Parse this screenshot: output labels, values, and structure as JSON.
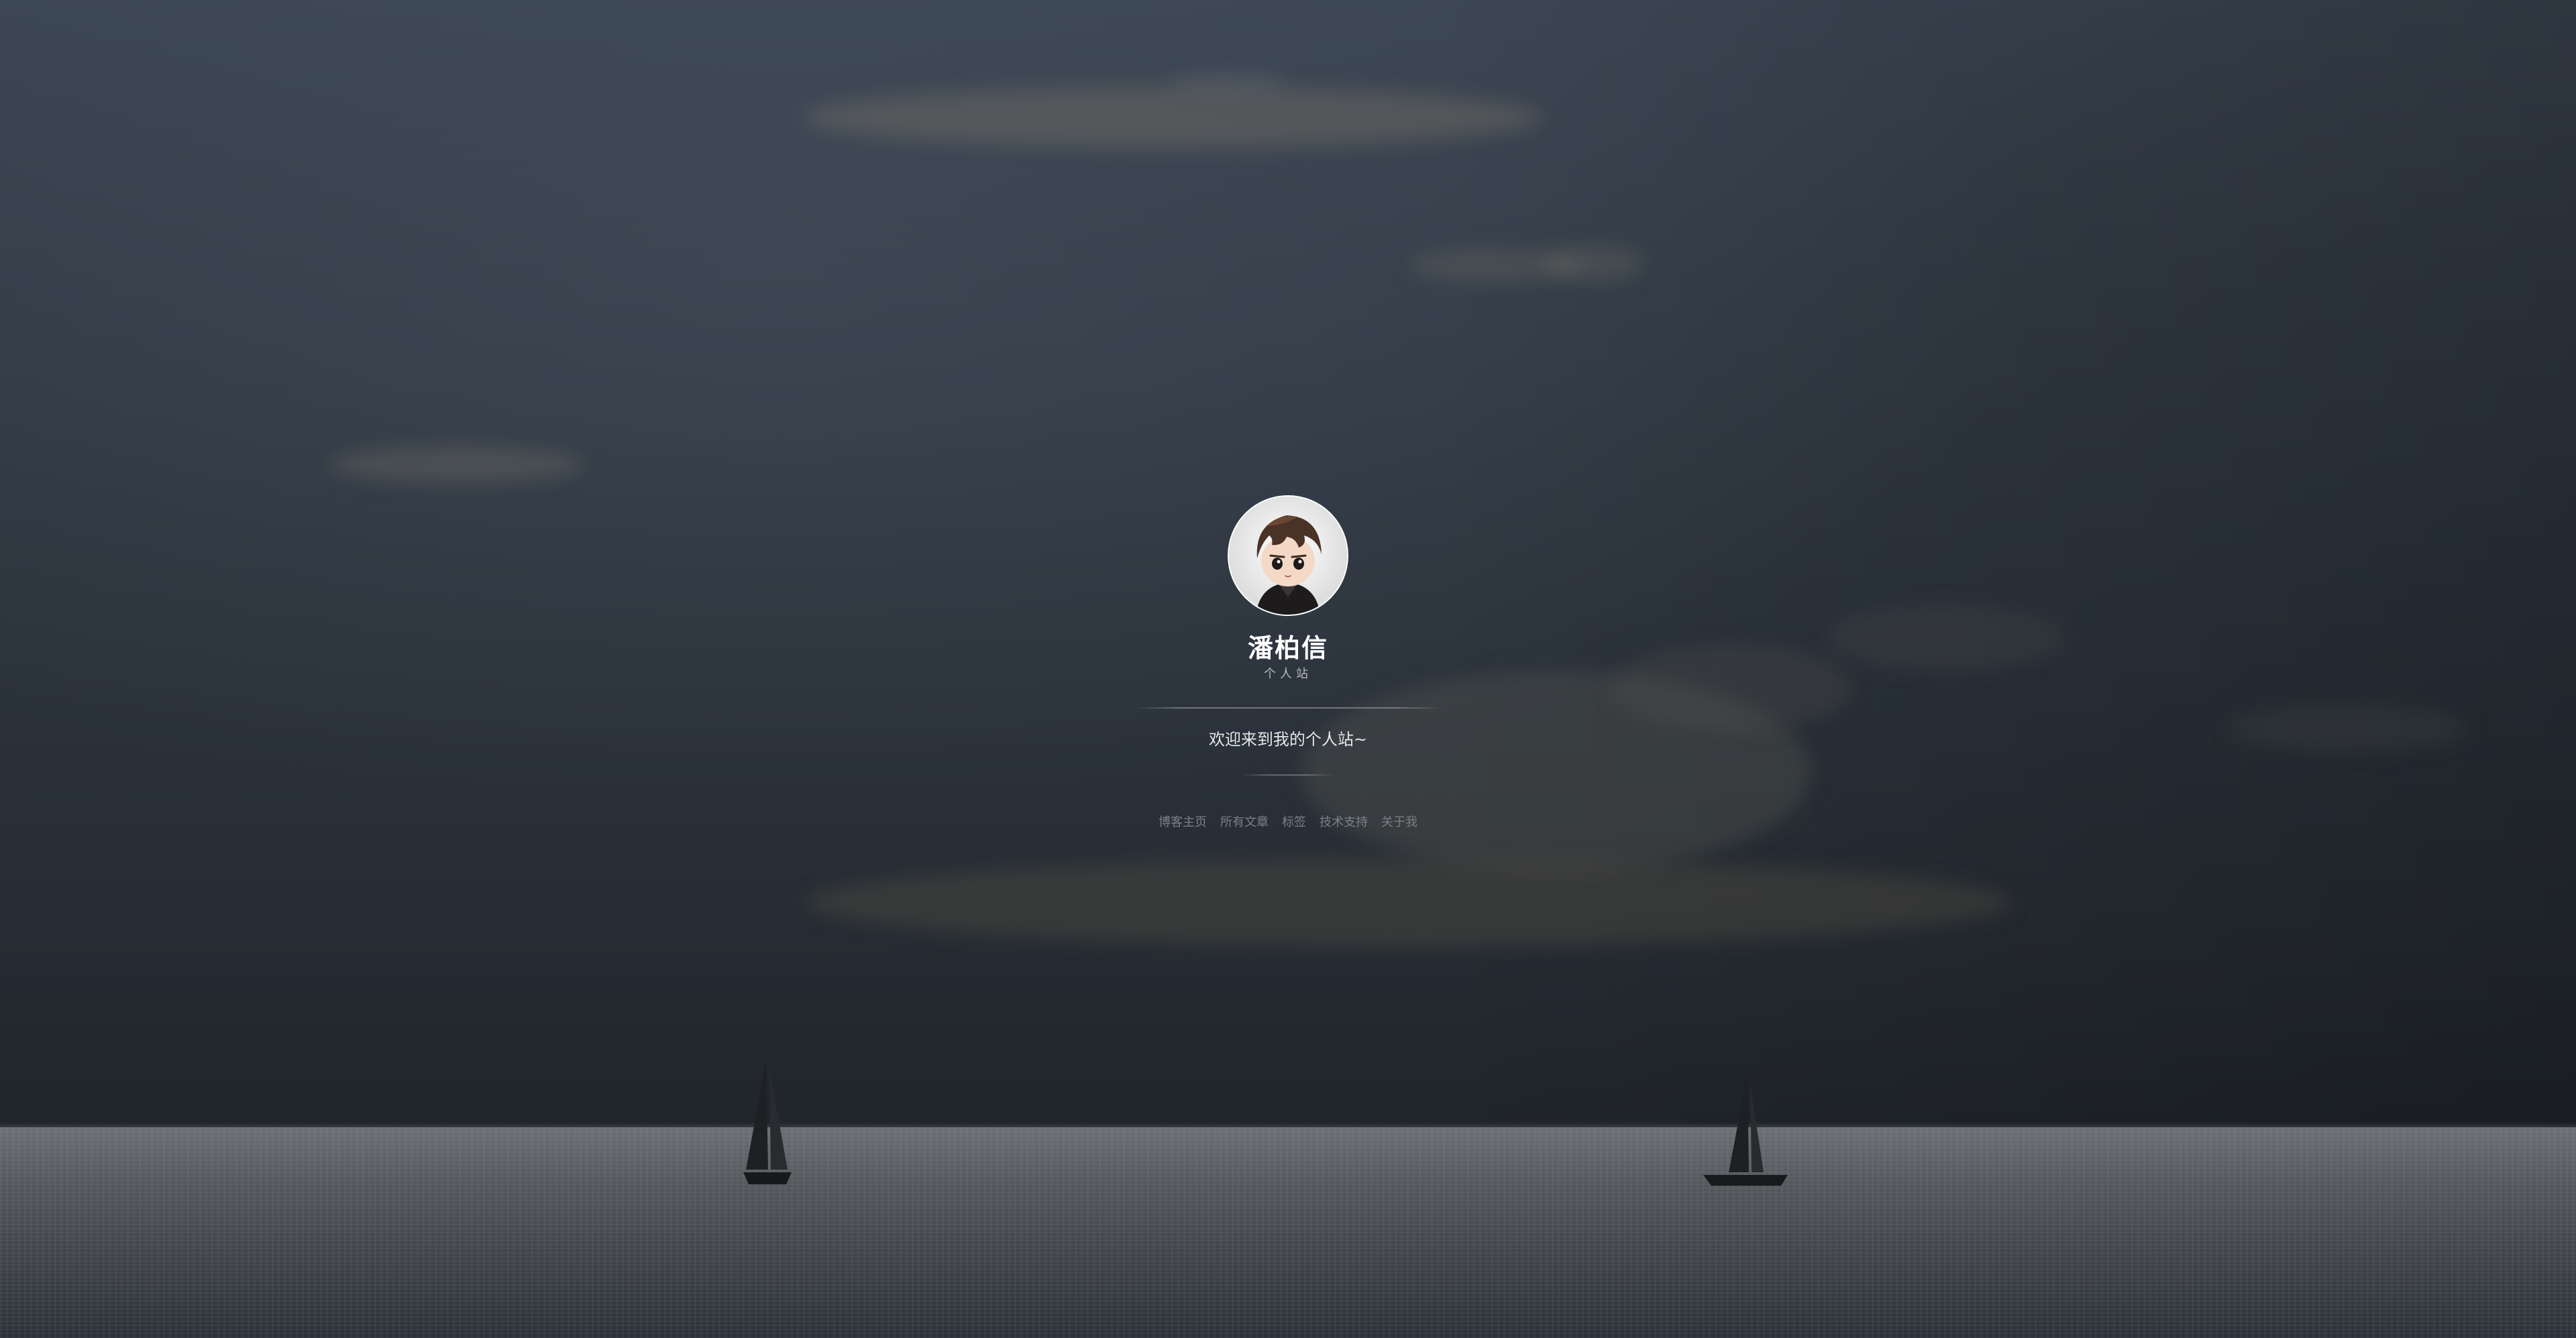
{
  "profile": {
    "name": "潘柏信",
    "subtitle": "个人站",
    "tagline": "欢迎来到我的个人站~",
    "avatar": "cartoon-boy-avatar"
  },
  "nav": {
    "items": [
      {
        "label": "博客主页"
      },
      {
        "label": "所有文章"
      },
      {
        "label": "标签"
      },
      {
        "label": "技术支持"
      },
      {
        "label": "关于我"
      }
    ]
  },
  "colors": {
    "sky": "#333c47",
    "sea": "#55595d",
    "name_text": "#ffffff",
    "nav_text": "#7b8087"
  }
}
